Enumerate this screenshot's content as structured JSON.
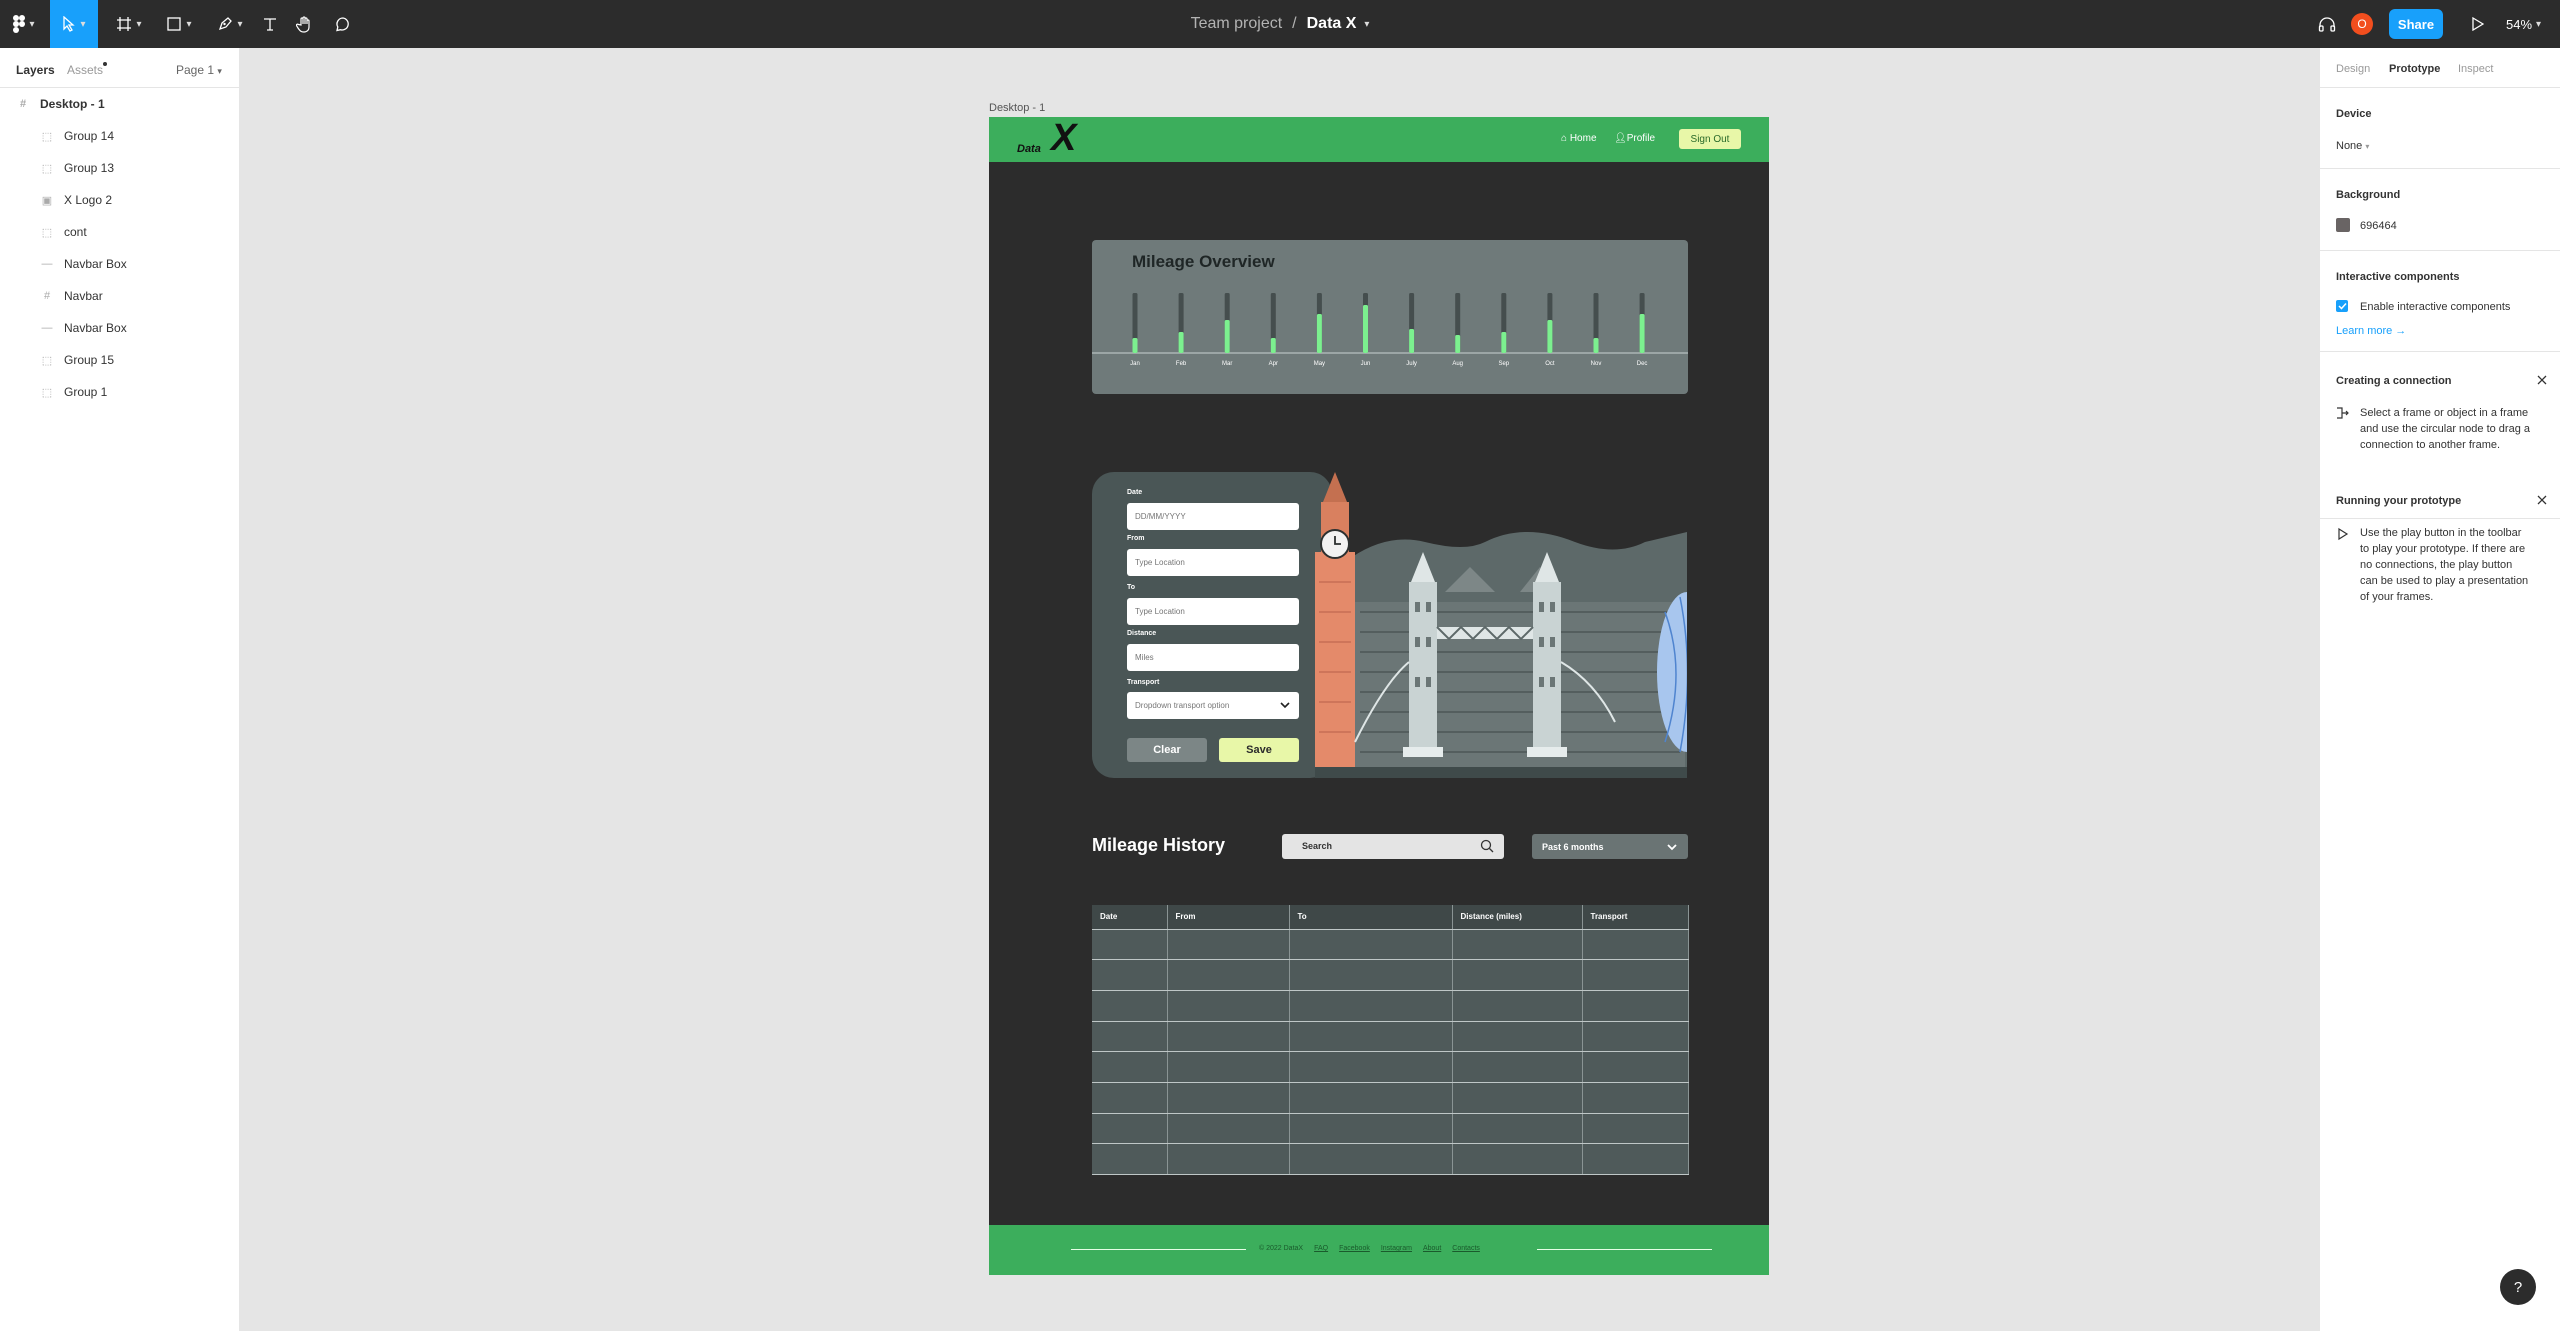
{
  "toolbar": {
    "project": "Team project",
    "separator": "/",
    "file_name": "Data X",
    "share_label": "Share",
    "avatar_initial": "O",
    "zoom": "54%"
  },
  "left_panel": {
    "tabs": {
      "layers": "Layers",
      "assets": "Assets"
    },
    "page": "Page 1",
    "layers": [
      {
        "name": "Desktop - 1",
        "icon": "frame-icon",
        "level": 0
      },
      {
        "name": "Group 14",
        "icon": "group-icon",
        "level": 1
      },
      {
        "name": "Group 13",
        "icon": "group-icon",
        "level": 1
      },
      {
        "name": "X Logo 2",
        "icon": "image-icon",
        "level": 1
      },
      {
        "name": "cont",
        "icon": "group-icon",
        "level": 1
      },
      {
        "name": "Navbar Box",
        "icon": "line-icon",
        "level": 1
      },
      {
        "name": "Navbar",
        "icon": "frame-icon",
        "level": 1
      },
      {
        "name": "Navbar Box",
        "icon": "line-icon",
        "level": 1
      },
      {
        "name": "Group 15",
        "icon": "group-icon",
        "level": 1
      },
      {
        "name": "Group 1",
        "icon": "group-icon",
        "level": 1
      }
    ]
  },
  "canvas": {
    "frame_label": "Desktop - 1",
    "nav": {
      "logo_text": "Data",
      "logo_mark": "X",
      "home": "Home",
      "profile": "Profile",
      "sign_out": "Sign Out"
    },
    "overview": {
      "title": "Mileage Overview"
    },
    "form": {
      "date_label": "Date",
      "date_placeholder": "DD/MM/YYYY",
      "from_label": "From",
      "from_placeholder": "Type Location",
      "to_label": "To",
      "to_placeholder": "Type Location",
      "distance_label": "Distance",
      "distance_placeholder": "Miles",
      "transport_label": "Transport",
      "transport_placeholder": "Dropdown transport option",
      "clear_label": "Clear",
      "save_label": "Save"
    },
    "history": {
      "title": "Mileage History",
      "search_label": "Search",
      "range_label": "Past 6 months",
      "columns": [
        "Date",
        "From",
        "To",
        "Distance (miles)",
        "Transport"
      ],
      "empty_rows": 8
    },
    "footer": {
      "links": [
        "© 2022 DataX",
        "FAQ",
        "Facebook",
        "Instagram",
        "About",
        "Contacts"
      ]
    }
  },
  "chart_data": {
    "type": "bar",
    "title": "Mileage Overview",
    "categories": [
      "Jan",
      "Feb",
      "Mar",
      "Apr",
      "May",
      "Jun",
      "July",
      "Aug",
      "Sep",
      "Oct",
      "Nov",
      "Dec"
    ],
    "values": [
      0.25,
      0.35,
      0.55,
      0.25,
      0.65,
      0.8,
      0.4,
      0.3,
      0.35,
      0.55,
      0.25,
      0.65
    ],
    "ylim": [
      0,
      1
    ],
    "colors": {
      "bar": "#7cf08f",
      "track": "#454e4e",
      "baseline": "#c9d1d1"
    }
  },
  "right_panel": {
    "tabs": {
      "design": "Design",
      "prototype": "Prototype",
      "inspect": "Inspect"
    },
    "device_title": "Device",
    "device_value": "None",
    "background_title": "Background",
    "background_value": "696464",
    "interactive_title": "Interactive components",
    "interactive_checkbox": "Enable interactive components",
    "learn_more": "Learn more →",
    "connection_title": "Creating a connection",
    "connection_body": "Select a frame or object in a frame and use the circular node to drag a connection to another frame.",
    "running_title": "Running your prototype",
    "running_body": "Use the play button in the toolbar to play your prototype. If there are no connections, the play button can be used to play a presentation of your frames."
  },
  "help_label": "?",
  "colors": {
    "accent": "#18a0fb",
    "frame_bg": "#2c2c2c",
    "nav_green": "#3cae5c",
    "highlight_yellow": "#e8f7a8"
  }
}
